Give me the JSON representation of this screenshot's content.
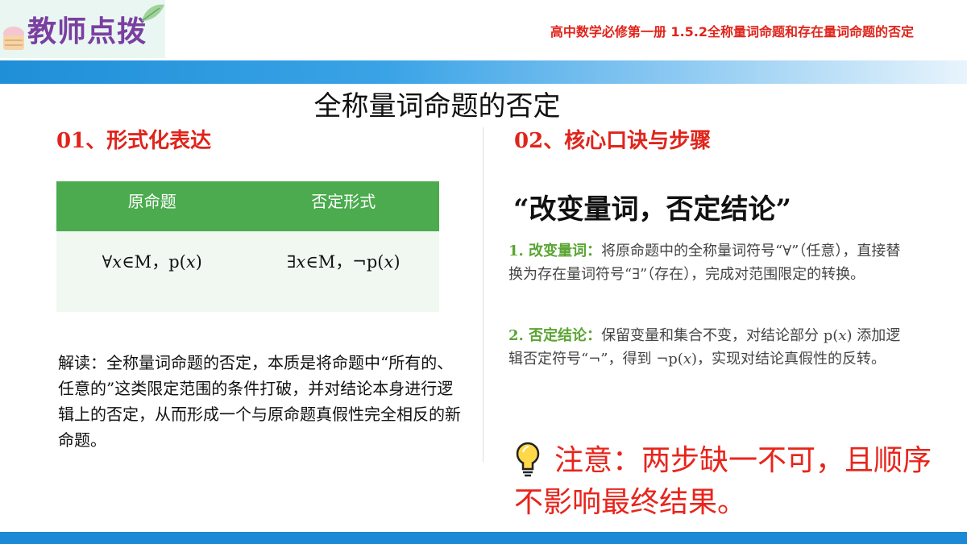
{
  "header": {
    "logo_text": "教师点拨",
    "book_title": "高中数学必修第一册   1.5.2全称量词命题和存在量词命题的否定"
  },
  "slide": {
    "title": "全称量词命题的否定"
  },
  "left": {
    "heading": "01、形式化表达",
    "table": {
      "headers": [
        "原命题",
        "否定形式"
      ],
      "row": [
        "∀𝑥∈M，p(𝑥)",
        "∃𝑥∈M，¬p(𝑥)"
      ]
    },
    "explanation": "解读：全称量词命题的否定，本质是将命题中“所有的、任意的”这类限定范围的条件打破，并对结论本身进行逻辑上的否定，从而形成一个与原命题真假性完全相反的新命题。"
  },
  "right": {
    "heading": "02、核心口诀与步骤",
    "slogan": "“改变量词，否定结论”",
    "steps": [
      {
        "label": "1. 改变量词：",
        "text": "将原命题中的全称量词符号“∀”（任意），直接替换为存在量词符号“∃”（存在），完成对范围限定的转换。"
      },
      {
        "label": "2. 否定结论：",
        "text": "保留变量和集合不变，对结论部分 p(𝑥) 添加逻辑否定符号“¬”，得到 ¬p(𝑥)，实现对结论真假性的反转。"
      }
    ],
    "note": "注意：两步缺一不可，且顺序不影响最终结果。",
    "note_icon": "lightbulb-icon"
  },
  "colors": {
    "accent_red": "#e0241b",
    "table_green": "#4bab4e",
    "step_green": "#5aa532",
    "band_blue": "#1a8ad6",
    "logo_purple": "#7a3fa0"
  }
}
